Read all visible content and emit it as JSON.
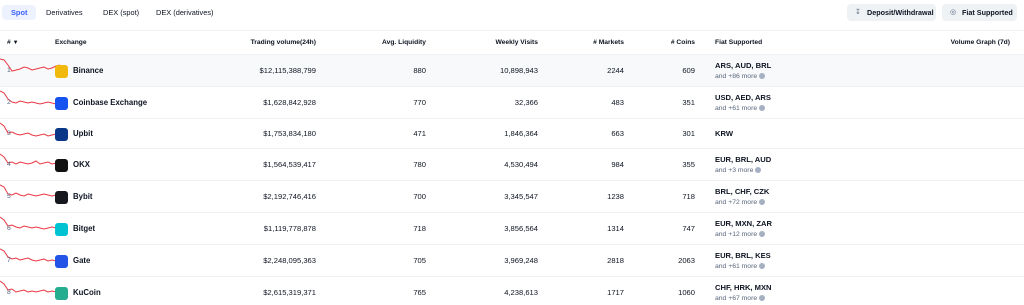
{
  "tabs": [
    {
      "label": "Spot",
      "active": true
    },
    {
      "label": "Derivatives",
      "active": false
    },
    {
      "label": "DEX (spot)",
      "active": false
    },
    {
      "label": "DEX (derivatives)",
      "active": false
    }
  ],
  "actions": {
    "deposit_label": "Deposit/Withdrawal",
    "fiat_label": "Fiat Supported"
  },
  "columns": {
    "rank": "#",
    "exchange": "Exchange",
    "volume": "Trading volume(24h)",
    "liquidity": "Avg. Liquidity",
    "visits": "Weekly Visits",
    "markets": "# Markets",
    "coins": "# Coins",
    "fiat": "Fiat Supported",
    "graph": "Volume Graph (7d)"
  },
  "colors": {
    "accent": "#3861fb",
    "sparkline": "#ea3943"
  },
  "rows": [
    {
      "rank": "1",
      "name": "Binance",
      "volume": "$12,115,388,799",
      "liquidity": "880",
      "visits": "10,898,943",
      "markets": "2244",
      "coins": "609",
      "fiat": "ARS, AUD, BRL",
      "more": "and +86 more",
      "logo_color": "#f0b90b",
      "spark": [
        20,
        19,
        14,
        8,
        9,
        10,
        12,
        11,
        9,
        10,
        11,
        12,
        10,
        11,
        13,
        14
      ]
    },
    {
      "rank": "2",
      "name": "Coinbase Exchange",
      "volume": "$1,628,842,928",
      "liquidity": "770",
      "visits": "32,366",
      "markets": "483",
      "coins": "351",
      "fiat": "USD, AED, ARS",
      "more": "and +61 more",
      "logo_color": "#1652f0",
      "spark": [
        20,
        18,
        12,
        9,
        8,
        10,
        9,
        8,
        9,
        8,
        7,
        8,
        9,
        8,
        7,
        8
      ]
    },
    {
      "rank": "3",
      "name": "Upbit",
      "volume": "$1,753,834,180",
      "liquidity": "471",
      "visits": "1,846,364",
      "markets": "663",
      "coins": "301",
      "fiat": "KRW",
      "more": "",
      "logo_color": "#093687",
      "spark": [
        20,
        17,
        10,
        11,
        9,
        8,
        9,
        10,
        8,
        7,
        8,
        9,
        7,
        8,
        9,
        7
      ]
    },
    {
      "rank": "4",
      "name": "OKX",
      "volume": "$1,564,539,417",
      "liquidity": "780",
      "visits": "4,530,494",
      "markets": "984",
      "coins": "355",
      "fiat": "EUR, BRL, AUD",
      "more": "and +3 more",
      "logo_color": "#111111",
      "spark": [
        19,
        16,
        10,
        11,
        9,
        11,
        10,
        9,
        10,
        12,
        9,
        10,
        11,
        9,
        10,
        9
      ]
    },
    {
      "rank": "5",
      "name": "Bybit",
      "volume": "$2,192,746,416",
      "liquidity": "700",
      "visits": "3,345,547",
      "markets": "1238",
      "coins": "718",
      "fiat": "BRL, CHF, CZK",
      "more": "and +72 more",
      "logo_color": "#17181e",
      "spark": [
        20,
        18,
        11,
        10,
        12,
        10,
        9,
        11,
        10,
        9,
        10,
        11,
        10,
        9,
        10,
        11
      ]
    },
    {
      "rank": "6",
      "name": "Bitget",
      "volume": "$1,119,778,878",
      "liquidity": "718",
      "visits": "3,856,564",
      "markets": "1314",
      "coins": "747",
      "fiat": "EUR, MXN, ZAR",
      "more": "and +12 more",
      "logo_color": "#00c2d1",
      "spark": [
        20,
        17,
        11,
        12,
        10,
        9,
        11,
        10,
        9,
        10,
        9,
        8,
        9,
        10,
        9,
        8
      ]
    },
    {
      "rank": "7",
      "name": "Gate",
      "volume": "$2,248,095,363",
      "liquidity": "705",
      "visits": "3,969,248",
      "markets": "2818",
      "coins": "2063",
      "fiat": "EUR, BRL, KES",
      "more": "and +61 more",
      "logo_color": "#2354e6",
      "spark": [
        20,
        18,
        12,
        10,
        11,
        9,
        10,
        11,
        9,
        8,
        9,
        10,
        8,
        9,
        8,
        9
      ]
    },
    {
      "rank": "8",
      "name": "KuCoin",
      "volume": "$2,615,319,371",
      "liquidity": "765",
      "visits": "4,238,613",
      "markets": "1717",
      "coins": "1060",
      "fiat": "CHF, HRK, MXN",
      "more": "and +67 more",
      "logo_color": "#24ae8f",
      "spark": [
        20,
        17,
        11,
        12,
        9,
        10,
        11,
        9,
        10,
        9,
        10,
        11,
        9,
        10,
        9,
        10
      ]
    }
  ]
}
